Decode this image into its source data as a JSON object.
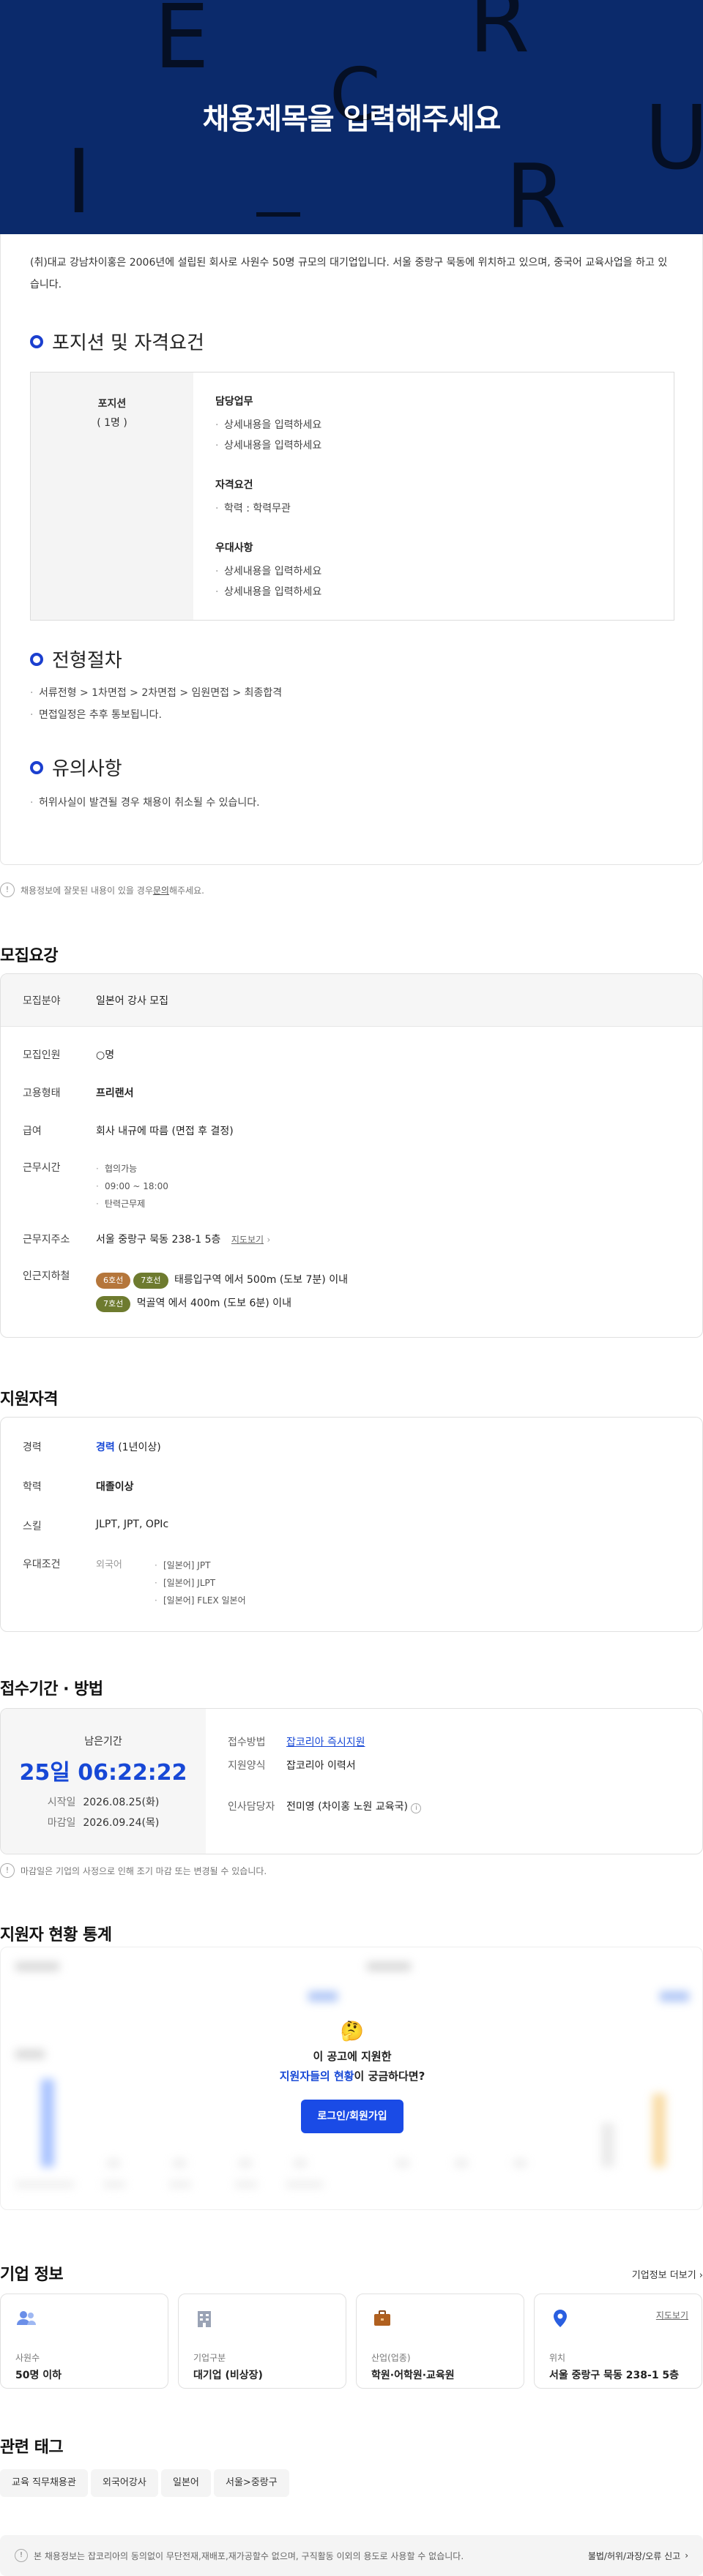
{
  "banner": {
    "title": "채용제목을 입력해주세요",
    "deco_letters": [
      "E",
      "R",
      "C",
      "I",
      "U",
      "R"
    ]
  },
  "intro": "(취)대교 강남차이홍은 2006년에 설립된 회사로 사원수 50명 규모의 대기업입니다. 서울 중랑구 묵동에 위치하고 있으며, 중국어 교육사업을 하고 있습니다.",
  "position_section": {
    "title": "포지션 및 자격요건",
    "position_label": "포지션",
    "position_count": "( 1명 )",
    "groups": [
      {
        "title": "담당업무",
        "items": [
          "상세내용을 입력하세요",
          "상세내용을 입력하세요"
        ]
      },
      {
        "title": "자격요건",
        "items": [
          "학력 : 학력무관"
        ]
      },
      {
        "title": "우대사항",
        "items": [
          "상세내용을 입력하세요",
          "상세내용을 입력하세요"
        ]
      }
    ]
  },
  "process_section": {
    "title": "전형절차",
    "items": [
      "서류전형 > 1차면접 > 2차면접 > 임원면접 > 최종합격",
      "면접일정은 추후 통보됩니다."
    ]
  },
  "caution_section": {
    "title": "유의사항",
    "items": [
      "허위사실이 발견될 경우 채용이 취소될 수 있습니다."
    ]
  },
  "report_notice": {
    "before": "채용정보에 잘못된 내용이 있을 경우 ",
    "link": "문의",
    "after": "해주세요."
  },
  "recruit": {
    "title": "모집요강",
    "field_label": "모집분야",
    "field_value": "일본어 강사 모집",
    "headcount_label": "모집인원",
    "headcount_value": "○명",
    "emp_label": "고용형태",
    "emp_value": "프리랜서",
    "salary_label": "급여",
    "salary_value": "회사 내규에 따름 (면접 후 결정)",
    "hours_label": "근무시간",
    "hours_items": [
      "협의가능",
      "09:00 ~ 18:00",
      "탄력근무제"
    ],
    "address_label": "근무지주소",
    "address_value": "서울 중랑구 묵동 238-1 5층",
    "map_link": "지도보기",
    "subway_label": "인근지하철",
    "subway": [
      {
        "badges": [
          {
            "text": "6호선",
            "color": "#b5763b"
          },
          {
            "text": "7호선",
            "color": "#6e7b2f"
          }
        ],
        "text": "태릉입구역 에서 500m (도보 7분) 이내"
      },
      {
        "badges": [
          {
            "text": "7호선",
            "color": "#6e7b2f"
          }
        ],
        "text": "먹골역 에서 400m (도보 6분) 이내"
      }
    ]
  },
  "qualify": {
    "title": "지원자격",
    "career_label": "경력",
    "career_strong": "경력",
    "career_rest": " (1년이상)",
    "edu_label": "학력",
    "edu_value": "대졸이상",
    "skill_label": "스킬",
    "skill_value": "JLPT, JPT, OPIc",
    "pref_label": "우대조건",
    "pref_sub": "외국어",
    "pref_items": [
      "[일본어] JPT",
      "[일본어] JLPT",
      "[일본어] FLEX 일본어"
    ]
  },
  "apply": {
    "title": "접수기간 · 방법",
    "remain_label": "남은기간",
    "timer": "25일 06:22:22",
    "start_label": "시작일",
    "start_value": "2026.08.25(화)",
    "end_label": "마감일",
    "end_value": "2026.09.24(목)",
    "method_label": "접수방법",
    "method_value": "잡코리아 즉시지원",
    "form_label": "지원양식",
    "form_value": "잡코리아 이력서",
    "hr_label": "인사담당자",
    "hr_value": "전미영 (차이홍 노원 교육국)",
    "notice": "마감일은 기업의 사정으로 인해 조기 마감 또는 변경될 수 있습니다."
  },
  "stats": {
    "title": "지원자 현황 통계",
    "emoji": "🤔",
    "line1": "이 공고에 지원한",
    "line2_strong": "지원자들의 현황",
    "line2_rest": "이 궁금하다면?",
    "button": "로그인/회원가입"
  },
  "company": {
    "title": "기업 정보",
    "more": "기업정보 더보기",
    "cards": [
      {
        "key": "사원수",
        "value": "50명 이하",
        "icon": "people-icon"
      },
      {
        "key": "기업구분",
        "value": "대기업 (비상장)",
        "icon": "building-icon"
      },
      {
        "key": "산업(업종)",
        "value": "학원·어학원·교육원",
        "icon": "briefcase-icon"
      },
      {
        "key": "위치",
        "value": "서울 중랑구 묵동 238-1 5층",
        "icon": "location-pin-icon",
        "link": "지도보기"
      }
    ]
  },
  "tags": {
    "title": "관련 태그",
    "items": [
      "교육 직무채용관",
      "외국어강사",
      "일본어",
      "서울>중랑구"
    ]
  },
  "footer": {
    "text": "본 채용정보는 잡코리아의 동의없이 무단전재,재배포,재가공할수 없으며, 구직활동 이외의 용도로 사용할 수 없습니다.",
    "report": "불법/허위/과장/오류 신고"
  }
}
